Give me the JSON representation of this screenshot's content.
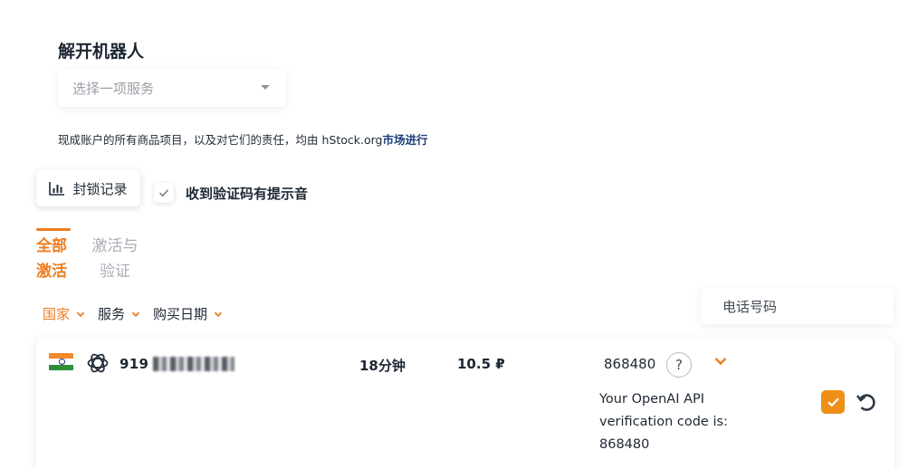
{
  "unlock": {
    "title": "解开机器人",
    "service_placeholder": "选择一项服务"
  },
  "notice": {
    "text": "现成账户的所有商品项目，以及对它们的责任，均由 hStock.org",
    "link": "市场进行"
  },
  "toolbar": {
    "ban_log_label": "封锁记录",
    "sound_label": "收到验证码有提示音",
    "sound_checked": true
  },
  "tabs": [
    {
      "label": "全部激活",
      "active": true
    },
    {
      "label": "激活与验证",
      "active": false
    }
  ],
  "filters": {
    "country": "国家",
    "service": "服务",
    "purchase_date": "购买日期"
  },
  "phone_search": {
    "placeholder": "电话号码"
  },
  "orders": [
    {
      "country_flag": "india-flag",
      "service_icon": "openai-icon",
      "phone": "919",
      "duration": "18分钟",
      "price": "10.5 ₽",
      "code": "868480",
      "help": "?",
      "sms": "Your OpenAI API verification code is: 868480",
      "done": true
    }
  ],
  "colors": {
    "accent": "#ee7d1e",
    "check_fill": "#ee8f17",
    "link": "#1b3e7a"
  }
}
